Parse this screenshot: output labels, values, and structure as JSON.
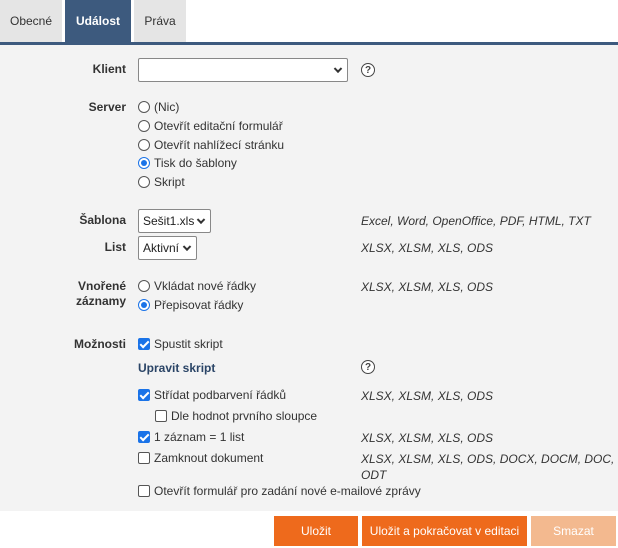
{
  "tabs": [
    {
      "label": "Obecné",
      "active": false
    },
    {
      "label": "Událost",
      "active": true
    },
    {
      "label": "Práva",
      "active": false
    }
  ],
  "form": {
    "klient": {
      "label": "Klient",
      "value": ""
    },
    "server": {
      "label": "Server",
      "options": [
        {
          "label": "(Nic)",
          "selected": false
        },
        {
          "label": "Otevřít editační formulář",
          "selected": false
        },
        {
          "label": "Otevřít nahlížecí stránku",
          "selected": false
        },
        {
          "label": "Tisk do šablony",
          "selected": true
        },
        {
          "label": "Skript",
          "selected": false
        }
      ]
    },
    "sablona": {
      "label": "Šablona",
      "value": "Sešit1.xls",
      "note": "Excel, Word, OpenOffice, PDF, HTML, TXT"
    },
    "list": {
      "label": "List",
      "value": "Aktivní",
      "note": "XLSX, XLSM, XLS, ODS"
    },
    "vnorene": {
      "label_line1": "Vnořené",
      "label_line2": "záznamy",
      "note": "XLSX, XLSM, XLS, ODS",
      "options": [
        {
          "label": "Vkládat nové řádky",
          "selected": false
        },
        {
          "label": "Přepisovat řádky",
          "selected": true
        }
      ]
    },
    "moznosti": {
      "label": "Možnosti",
      "spustit_skript": {
        "label": "Spustit skript",
        "checked": true
      },
      "upravit_skript": "Upravit skript",
      "stridat": {
        "label": "Střídat podbarvení řádků",
        "checked": true,
        "note": "XLSX, XLSM, XLS, ODS"
      },
      "dle_hodnot": {
        "label": "Dle hodnot prvního sloupce",
        "checked": false
      },
      "jeden_zaznam": {
        "label": "1 záznam = 1 list",
        "checked": true,
        "note": "XLSX, XLSM, XLS, ODS"
      },
      "zamknout": {
        "label": "Zamknout dokument",
        "checked": false,
        "note_line1": "XLSX, XLSM, XLS, ODS, DOCX, DOCM, DOC,",
        "note_line2": "ODT"
      },
      "otevrit_formular": {
        "label": "Otevřít formulář pro zadání nové e-mailové zprávy",
        "checked": false
      }
    },
    "help_symbol": "?"
  },
  "buttons": {
    "save": "Uložit",
    "save_continue": "Uložit a pokračovat v editaci",
    "delete": "Smazat"
  },
  "colors": {
    "tab_active": "#3d5a7e",
    "primary_button": "#ee6a1c",
    "disabled_button": "#f3b98f",
    "form_background": "#f3f3f3"
  }
}
